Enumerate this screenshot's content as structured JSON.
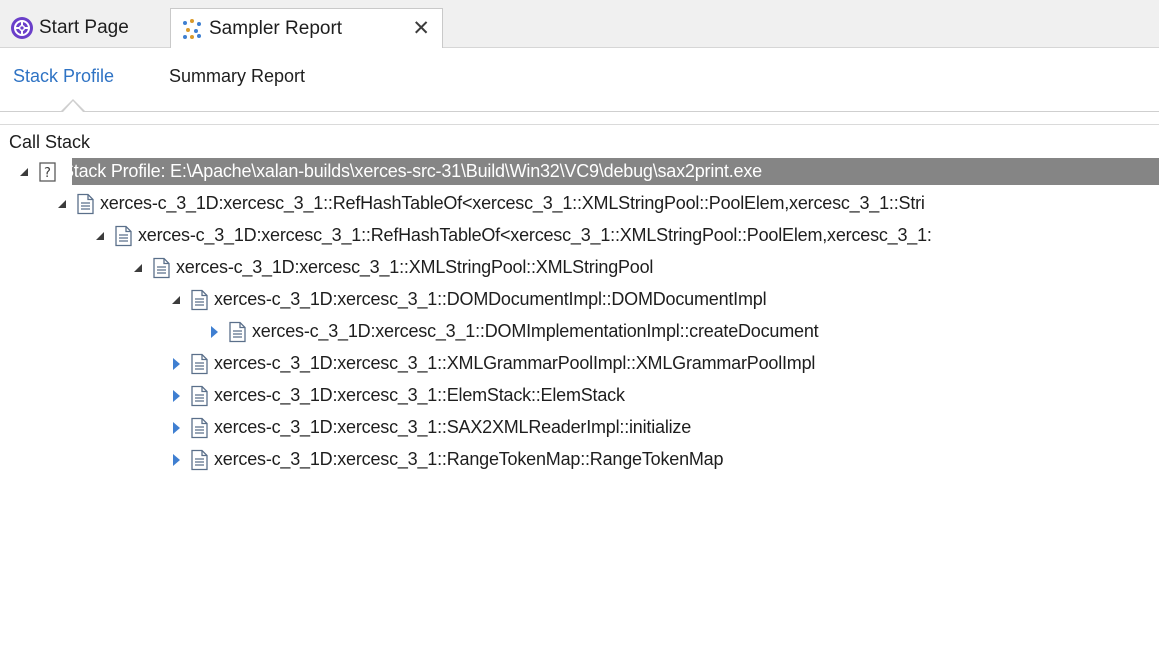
{
  "tabs": {
    "start": {
      "label": "Start Page",
      "icon": "ea-logo-icon"
    },
    "sampler": {
      "label": "Sampler Report",
      "icon": "profiler-icon",
      "close": "✕"
    }
  },
  "view_tabs": {
    "stack_profile": "Stack Profile",
    "summary_report": "Summary Report"
  },
  "panel": {
    "label": "Call Stack"
  },
  "tree": {
    "nodes": [
      {
        "text": "Stack Profile: E:\\Apache\\xalan-builds\\xerces-src-31\\Build\\Win32\\VC9\\debug\\sax2print.exe",
        "level": 0,
        "state": "expanded",
        "icon": "question-file-icon",
        "selected": true
      },
      {
        "text": "xerces-c_3_1D:xercesc_3_1::RefHashTableOf<xercesc_3_1::XMLStringPool::PoolElem,xercesc_3_1::Stri",
        "level": 1,
        "state": "expanded",
        "icon": "document-icon",
        "selected": false
      },
      {
        "text": "xerces-c_3_1D:xercesc_3_1::RefHashTableOf<xercesc_3_1::XMLStringPool::PoolElem,xercesc_3_1:",
        "level": 2,
        "state": "expanded",
        "icon": "document-icon",
        "selected": false
      },
      {
        "text": "xerces-c_3_1D:xercesc_3_1::XMLStringPool::XMLStringPool",
        "level": 3,
        "state": "expanded",
        "icon": "document-icon",
        "selected": false
      },
      {
        "text": "xerces-c_3_1D:xercesc_3_1::DOMDocumentImpl::DOMDocumentImpl",
        "level": 4,
        "state": "expanded",
        "icon": "document-icon",
        "selected": false
      },
      {
        "text": "xerces-c_3_1D:xercesc_3_1::DOMImplementationImpl::createDocument",
        "level": 5,
        "state": "collapsed",
        "icon": "document-icon",
        "selected": false
      },
      {
        "text": "xerces-c_3_1D:xercesc_3_1::XMLGrammarPoolImpl::XMLGrammarPoolImpl",
        "level": 4,
        "state": "collapsed",
        "icon": "document-icon",
        "selected": false
      },
      {
        "text": "xerces-c_3_1D:xercesc_3_1::ElemStack::ElemStack",
        "level": 4,
        "state": "collapsed",
        "icon": "document-icon",
        "selected": false
      },
      {
        "text": "xerces-c_3_1D:xercesc_3_1::SAX2XMLReaderImpl::initialize",
        "level": 4,
        "state": "collapsed",
        "icon": "document-icon",
        "selected": false
      },
      {
        "text": "xerces-c_3_1D:xercesc_3_1::RangeTokenMap::RangeTokenMap",
        "level": 4,
        "state": "collapsed",
        "icon": "document-icon",
        "selected": false
      }
    ]
  },
  "colors": {
    "accent": "#2f73c4",
    "selection": "#858585",
    "expander_collapsed": "#3f7fd1",
    "expander_expanded": "#3c3c3c"
  }
}
